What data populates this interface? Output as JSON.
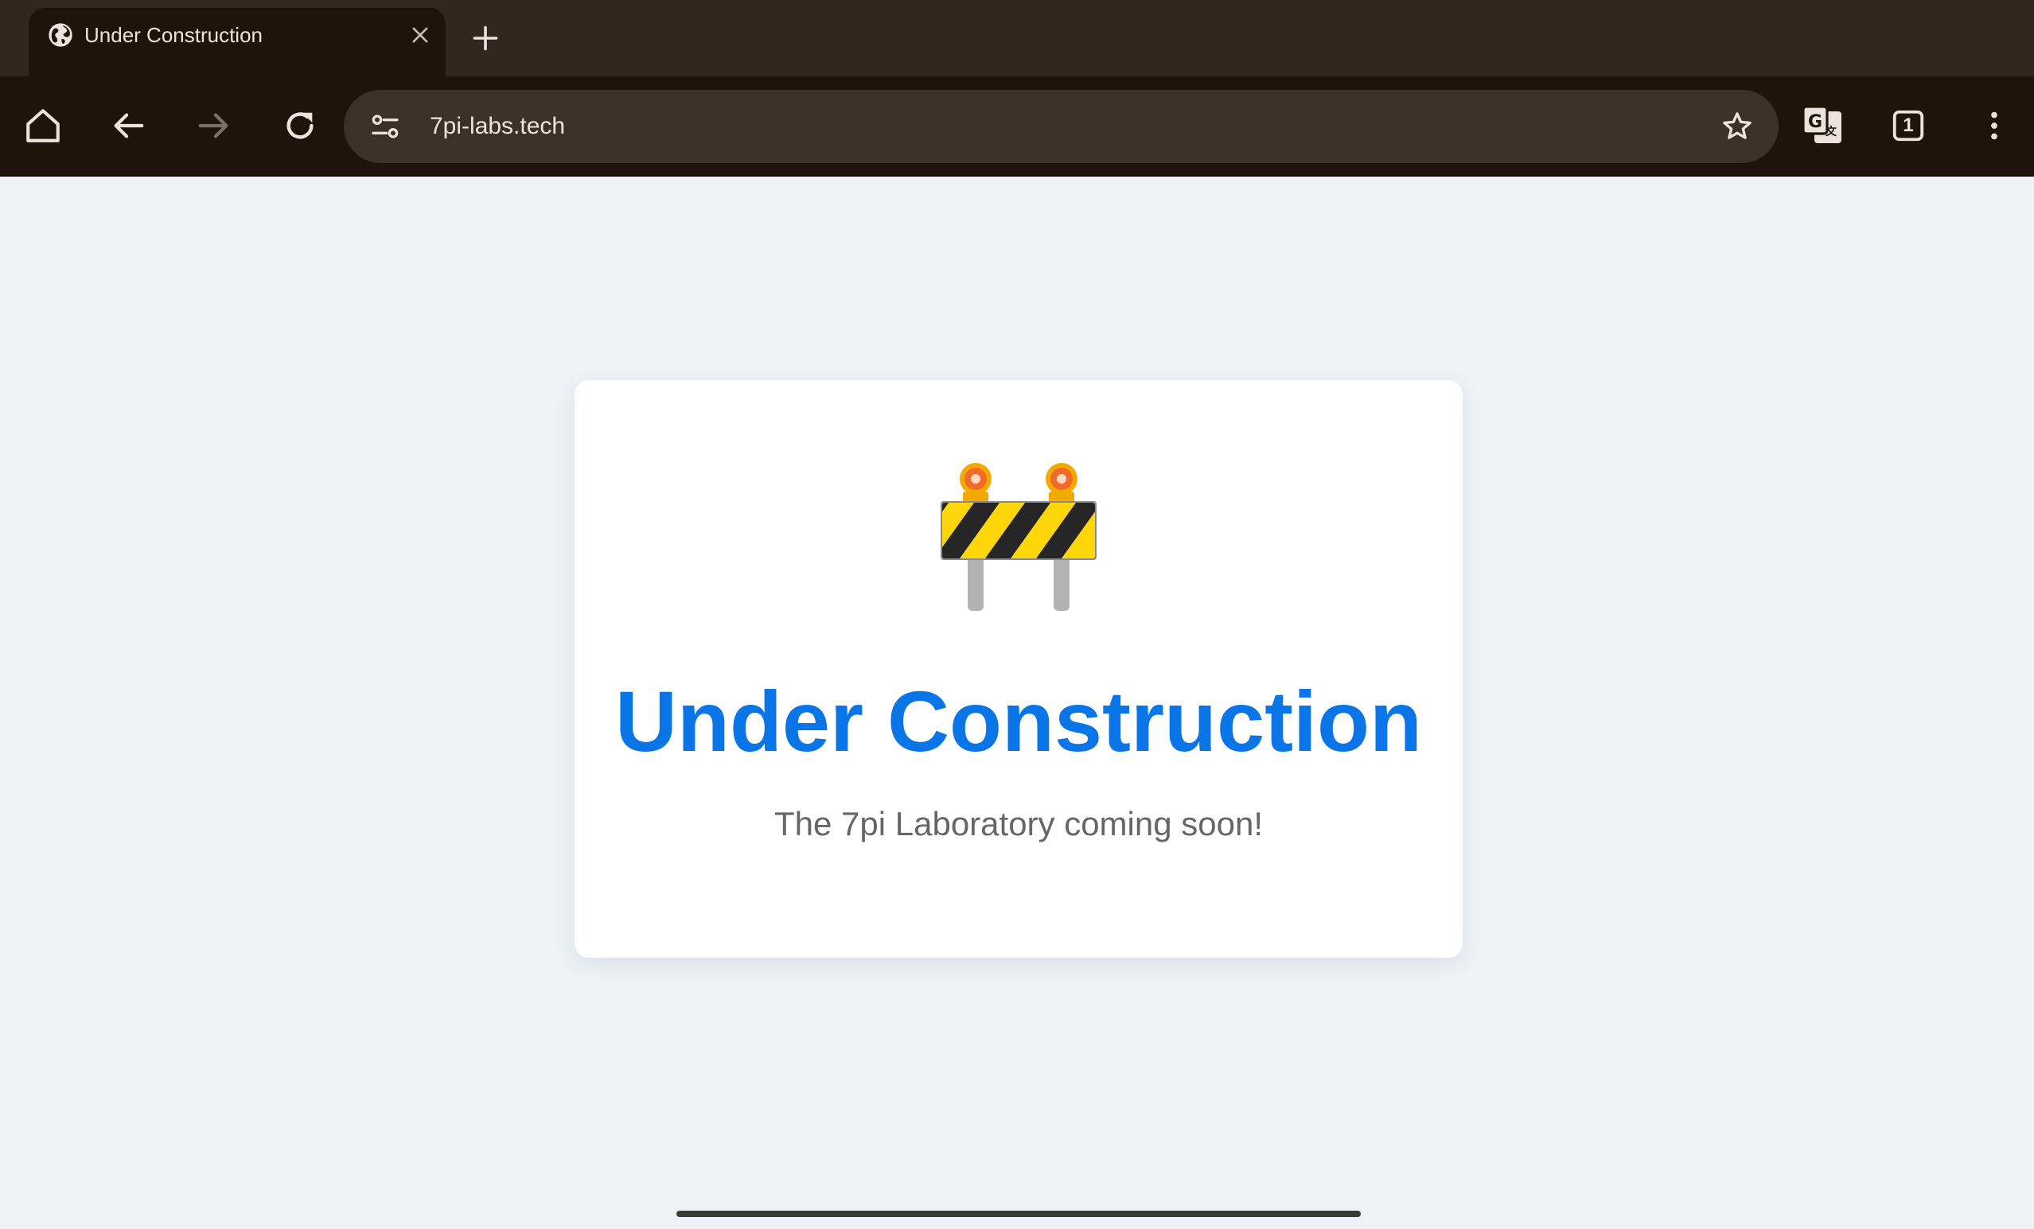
{
  "browser": {
    "tab": {
      "title": "Under Construction",
      "icon": "globe-icon"
    },
    "toolbar": {
      "icons": [
        "home-icon",
        "back-arrow-icon",
        "forward-arrow-icon",
        "reload-icon",
        "site-settings-icon",
        "bookmark-star-icon",
        "translate-icon",
        "tab-switcher-icon",
        "overflow-menu-icon"
      ],
      "tab_count": "1"
    },
    "omnibox": {
      "url": "7pi-labs.tech"
    },
    "colors": {
      "tabstrip": "#32261e",
      "toolbar": "#1e1409",
      "omnibox": "#3c3128"
    }
  },
  "page": {
    "illustration": "construction-barrier-icon",
    "heading": "Under Construction",
    "subtext": "The 7pi Laboratory coming soon!",
    "colors": {
      "background": "#eff3f8",
      "heading": "#0a75e6",
      "subtext": "#666666"
    }
  }
}
